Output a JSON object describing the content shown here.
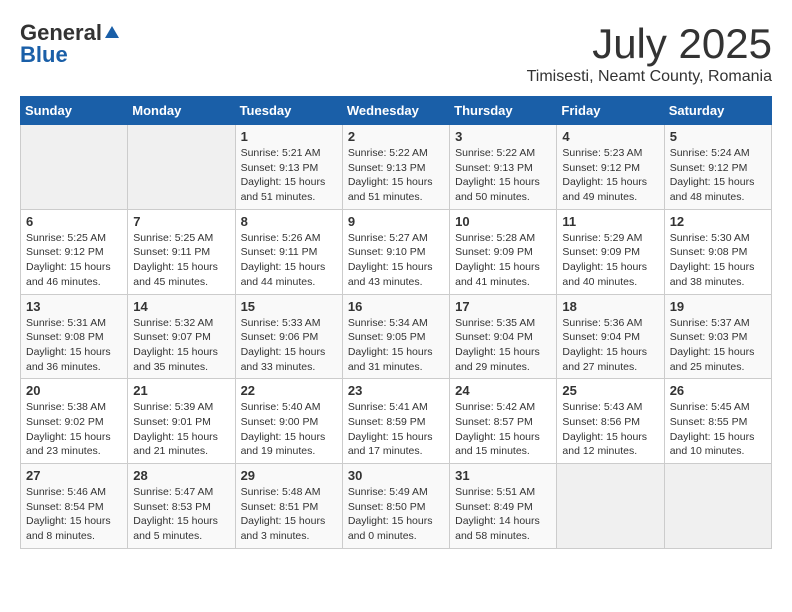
{
  "header": {
    "logo_general": "General",
    "logo_blue": "Blue",
    "title": "July 2025",
    "location": "Timisesti, Neamt County, Romania"
  },
  "calendar": {
    "days_of_week": [
      "Sunday",
      "Monday",
      "Tuesday",
      "Wednesday",
      "Thursday",
      "Friday",
      "Saturday"
    ],
    "weeks": [
      [
        {
          "day": "",
          "info": ""
        },
        {
          "day": "",
          "info": ""
        },
        {
          "day": "1",
          "info": "Sunrise: 5:21 AM\nSunset: 9:13 PM\nDaylight: 15 hours and 51 minutes."
        },
        {
          "day": "2",
          "info": "Sunrise: 5:22 AM\nSunset: 9:13 PM\nDaylight: 15 hours and 51 minutes."
        },
        {
          "day": "3",
          "info": "Sunrise: 5:22 AM\nSunset: 9:13 PM\nDaylight: 15 hours and 50 minutes."
        },
        {
          "day": "4",
          "info": "Sunrise: 5:23 AM\nSunset: 9:12 PM\nDaylight: 15 hours and 49 minutes."
        },
        {
          "day": "5",
          "info": "Sunrise: 5:24 AM\nSunset: 9:12 PM\nDaylight: 15 hours and 48 minutes."
        }
      ],
      [
        {
          "day": "6",
          "info": "Sunrise: 5:25 AM\nSunset: 9:12 PM\nDaylight: 15 hours and 46 minutes."
        },
        {
          "day": "7",
          "info": "Sunrise: 5:25 AM\nSunset: 9:11 PM\nDaylight: 15 hours and 45 minutes."
        },
        {
          "day": "8",
          "info": "Sunrise: 5:26 AM\nSunset: 9:11 PM\nDaylight: 15 hours and 44 minutes."
        },
        {
          "day": "9",
          "info": "Sunrise: 5:27 AM\nSunset: 9:10 PM\nDaylight: 15 hours and 43 minutes."
        },
        {
          "day": "10",
          "info": "Sunrise: 5:28 AM\nSunset: 9:09 PM\nDaylight: 15 hours and 41 minutes."
        },
        {
          "day": "11",
          "info": "Sunrise: 5:29 AM\nSunset: 9:09 PM\nDaylight: 15 hours and 40 minutes."
        },
        {
          "day": "12",
          "info": "Sunrise: 5:30 AM\nSunset: 9:08 PM\nDaylight: 15 hours and 38 minutes."
        }
      ],
      [
        {
          "day": "13",
          "info": "Sunrise: 5:31 AM\nSunset: 9:08 PM\nDaylight: 15 hours and 36 minutes."
        },
        {
          "day": "14",
          "info": "Sunrise: 5:32 AM\nSunset: 9:07 PM\nDaylight: 15 hours and 35 minutes."
        },
        {
          "day": "15",
          "info": "Sunrise: 5:33 AM\nSunset: 9:06 PM\nDaylight: 15 hours and 33 minutes."
        },
        {
          "day": "16",
          "info": "Sunrise: 5:34 AM\nSunset: 9:05 PM\nDaylight: 15 hours and 31 minutes."
        },
        {
          "day": "17",
          "info": "Sunrise: 5:35 AM\nSunset: 9:04 PM\nDaylight: 15 hours and 29 minutes."
        },
        {
          "day": "18",
          "info": "Sunrise: 5:36 AM\nSunset: 9:04 PM\nDaylight: 15 hours and 27 minutes."
        },
        {
          "day": "19",
          "info": "Sunrise: 5:37 AM\nSunset: 9:03 PM\nDaylight: 15 hours and 25 minutes."
        }
      ],
      [
        {
          "day": "20",
          "info": "Sunrise: 5:38 AM\nSunset: 9:02 PM\nDaylight: 15 hours and 23 minutes."
        },
        {
          "day": "21",
          "info": "Sunrise: 5:39 AM\nSunset: 9:01 PM\nDaylight: 15 hours and 21 minutes."
        },
        {
          "day": "22",
          "info": "Sunrise: 5:40 AM\nSunset: 9:00 PM\nDaylight: 15 hours and 19 minutes."
        },
        {
          "day": "23",
          "info": "Sunrise: 5:41 AM\nSunset: 8:59 PM\nDaylight: 15 hours and 17 minutes."
        },
        {
          "day": "24",
          "info": "Sunrise: 5:42 AM\nSunset: 8:57 PM\nDaylight: 15 hours and 15 minutes."
        },
        {
          "day": "25",
          "info": "Sunrise: 5:43 AM\nSunset: 8:56 PM\nDaylight: 15 hours and 12 minutes."
        },
        {
          "day": "26",
          "info": "Sunrise: 5:45 AM\nSunset: 8:55 PM\nDaylight: 15 hours and 10 minutes."
        }
      ],
      [
        {
          "day": "27",
          "info": "Sunrise: 5:46 AM\nSunset: 8:54 PM\nDaylight: 15 hours and 8 minutes."
        },
        {
          "day": "28",
          "info": "Sunrise: 5:47 AM\nSunset: 8:53 PM\nDaylight: 15 hours and 5 minutes."
        },
        {
          "day": "29",
          "info": "Sunrise: 5:48 AM\nSunset: 8:51 PM\nDaylight: 15 hours and 3 minutes."
        },
        {
          "day": "30",
          "info": "Sunrise: 5:49 AM\nSunset: 8:50 PM\nDaylight: 15 hours and 0 minutes."
        },
        {
          "day": "31",
          "info": "Sunrise: 5:51 AM\nSunset: 8:49 PM\nDaylight: 14 hours and 58 minutes."
        },
        {
          "day": "",
          "info": ""
        },
        {
          "day": "",
          "info": ""
        }
      ]
    ]
  }
}
